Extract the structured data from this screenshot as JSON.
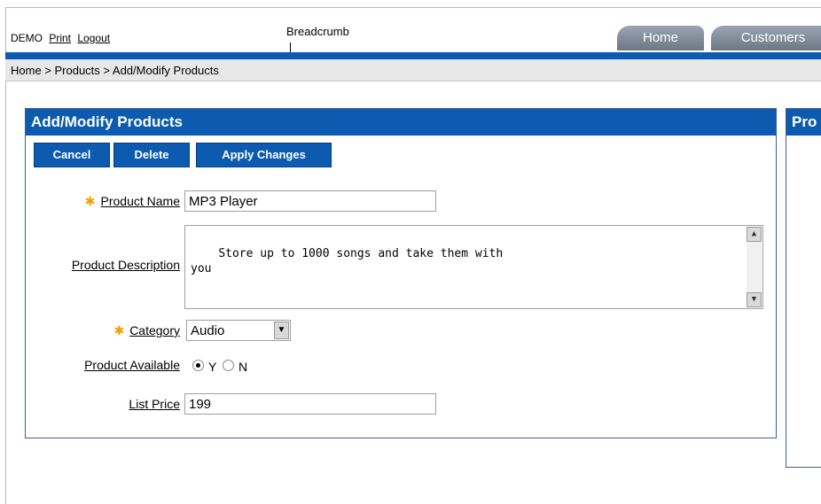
{
  "top_links": {
    "user": "DEMO",
    "print": "Print",
    "logout": "Logout"
  },
  "callout": "Breadcrumb",
  "tabs": [
    {
      "label": "Home"
    },
    {
      "label": "Customers"
    }
  ],
  "breadcrumb": "Home > Products > Add/Modify Products",
  "form": {
    "title": "Add/Modify Products",
    "buttons": {
      "cancel": "Cancel",
      "delete": "Delete",
      "apply": "Apply Changes"
    },
    "product_name": {
      "label": "Product Name",
      "value": "MP3 Player",
      "required": true
    },
    "product_description": {
      "label": "Product Description",
      "value": "Store up to 1000 songs and take them with\nyou"
    },
    "category": {
      "label": "Category",
      "value": "Audio",
      "required": true
    },
    "product_available": {
      "label": "Product Available",
      "options": [
        "Y",
        "N"
      ],
      "selected": "Y"
    },
    "list_price": {
      "label": "List Price",
      "value": "199"
    }
  },
  "right_panel_title": "Pro",
  "colors": {
    "accent": "#0c5bb0",
    "required": "#f0a000"
  }
}
